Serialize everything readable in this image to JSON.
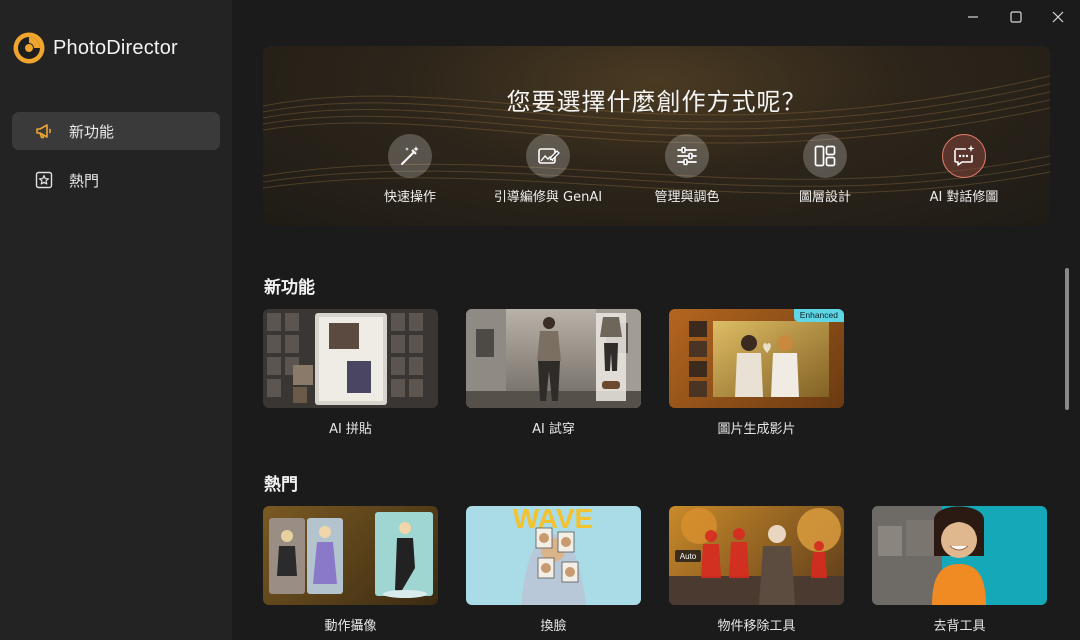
{
  "app": {
    "name": "PhotoDirector"
  },
  "sidebar": {
    "items": [
      {
        "label": "新功能",
        "icon": "megaphone-icon",
        "active": true
      },
      {
        "label": "熱門",
        "icon": "star-icon",
        "active": false
      }
    ]
  },
  "window": {
    "controls": [
      "minimize-icon",
      "maximize-icon",
      "close-icon"
    ]
  },
  "hero": {
    "title": "您要選擇什麼創作方式呢？",
    "actions": [
      {
        "label": "快速操作",
        "icon": "magic-wand-icon"
      },
      {
        "label": "引導編修與 GenAI",
        "icon": "image-edit-icon"
      },
      {
        "label": "管理與調色",
        "icon": "sliders-icon"
      },
      {
        "label": "圖層設計",
        "icon": "layers-layout-icon"
      },
      {
        "label": "AI 對話修圖",
        "icon": "chat-sparkle-icon"
      }
    ]
  },
  "sections": {
    "new": {
      "title": "新功能",
      "cards": [
        {
          "label": "AI 拼貼",
          "badge": ""
        },
        {
          "label": "AI 試穿",
          "badge": ""
        },
        {
          "label": "圖片生成影片",
          "badge": "Enhanced"
        }
      ]
    },
    "hot": {
      "title": "熱門",
      "cards": [
        {
          "label": "動作攝像",
          "overlay": ""
        },
        {
          "label": "換臉",
          "overlay": "WAVE"
        },
        {
          "label": "物件移除工具",
          "overlay": "Auto"
        },
        {
          "label": "去背工具",
          "overlay": ""
        }
      ]
    }
  },
  "colors": {
    "accent": "#e8a43a",
    "badge": "#5fd6e6",
    "chat_ring": "#e77d6a"
  }
}
